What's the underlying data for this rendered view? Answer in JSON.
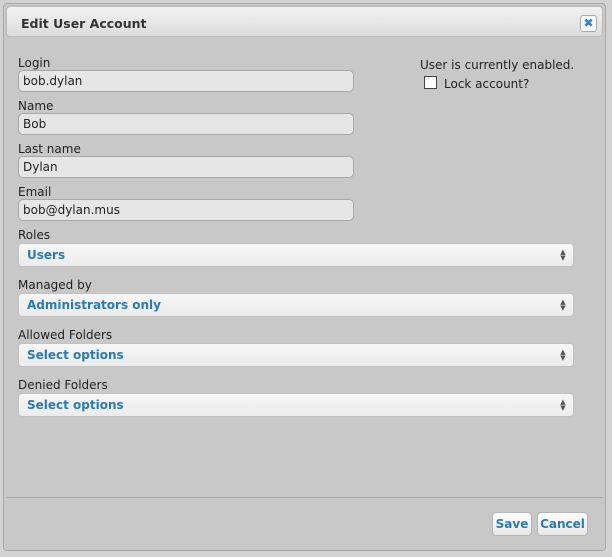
{
  "dialog": {
    "title": "Edit User Account",
    "close_icon": "close-icon"
  },
  "form": {
    "login_label": "Login",
    "login_value": "bob.dylan",
    "name_label": "Name",
    "name_value": "Bob",
    "lastname_label": "Last name",
    "lastname_value": "Dylan",
    "email_label": "Email",
    "email_value": "bob@dylan.mus",
    "roles_label": "Roles",
    "roles_value": "Users",
    "managed_label": "Managed by",
    "managed_value": "Administrators only",
    "allowed_label": "Allowed Folders",
    "allowed_value": "Select options",
    "denied_label": "Denied Folders",
    "denied_value": "Select options"
  },
  "status": {
    "enabled_text": "User is currently enabled.",
    "lock_label": "Lock account?",
    "lock_checked": false
  },
  "footer": {
    "save_label": "Save",
    "cancel_label": "Cancel"
  },
  "colors": {
    "accent": "#2a7ab8",
    "dialog_bg": "#c8c8c8"
  }
}
